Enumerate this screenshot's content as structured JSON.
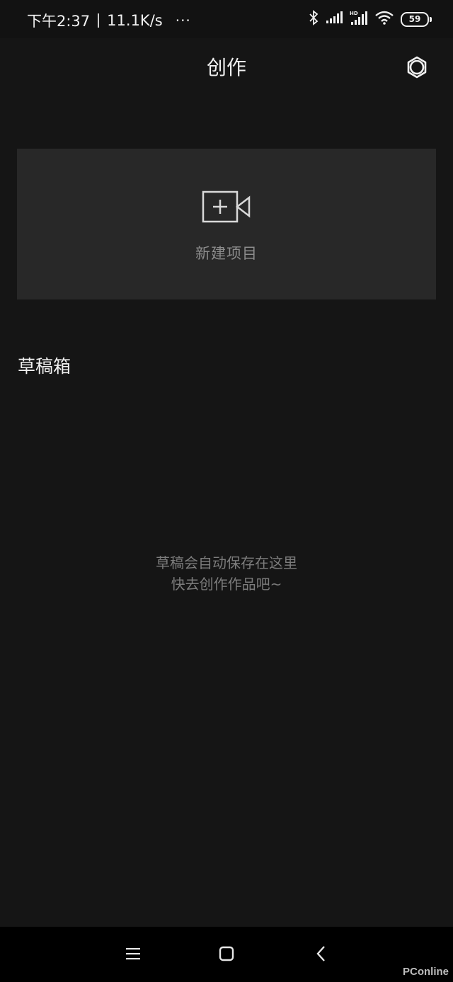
{
  "status_bar": {
    "time": "下午2:37",
    "network_speed": "11.1K/s",
    "more": "···",
    "battery_level": "59"
  },
  "header": {
    "title": "创作"
  },
  "new_project": {
    "label": "新建项目",
    "icon": "video-camera-plus-icon"
  },
  "drafts": {
    "title": "草稿箱",
    "empty_line1": "草稿会自动保存在这里",
    "empty_line2": "快去创作作品吧~"
  },
  "nav": {
    "menu": "menu-icon",
    "home": "home-icon",
    "back": "back-icon"
  },
  "watermark": "PConline",
  "colors": {
    "background": "#151515",
    "card": "#282828",
    "text": "#efefef",
    "muted": "#7c7c7c"
  }
}
